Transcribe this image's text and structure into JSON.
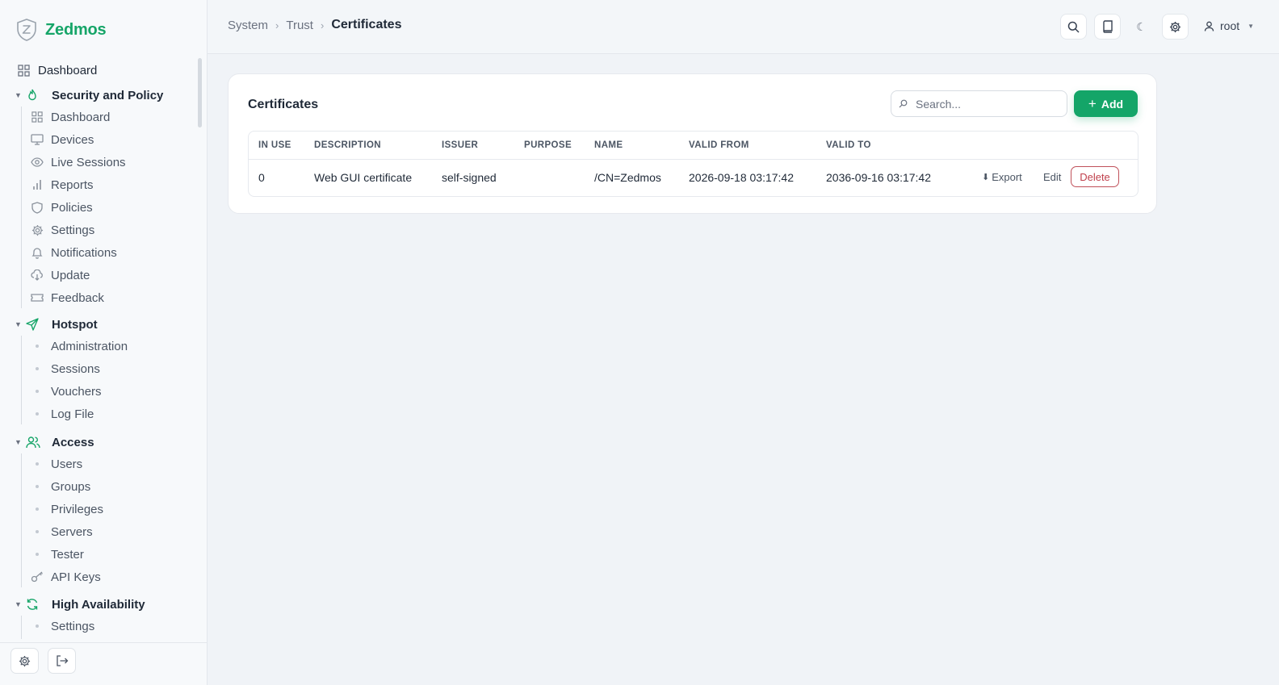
{
  "brand": {
    "name": "Zedmos",
    "color": "#16a568"
  },
  "sidebar": {
    "top_item": {
      "label": "Dashboard",
      "icon": "dashboard-grid-icon"
    },
    "sections": [
      {
        "label": "Security and Policy",
        "icon": "flame-icon",
        "items": [
          {
            "label": "Dashboard",
            "icon": "dashboard-grid-icon"
          },
          {
            "label": "Devices",
            "icon": "monitor-icon"
          },
          {
            "label": "Live Sessions",
            "icon": "eye-icon"
          },
          {
            "label": "Reports",
            "icon": "bar-chart-icon"
          },
          {
            "label": "Policies",
            "icon": "shield-icon"
          },
          {
            "label": "Settings",
            "icon": "gear-icon"
          },
          {
            "label": "Notifications",
            "icon": "bell-icon"
          },
          {
            "label": "Update",
            "icon": "cloud-download-icon"
          },
          {
            "label": "Feedback",
            "icon": "ticket-icon"
          }
        ]
      },
      {
        "label": "Hotspot",
        "icon": "send-icon",
        "items": [
          {
            "label": "Administration"
          },
          {
            "label": "Sessions"
          },
          {
            "label": "Vouchers"
          },
          {
            "label": "Log File"
          }
        ]
      },
      {
        "label": "Access",
        "icon": "users-icon",
        "items": [
          {
            "label": "Users"
          },
          {
            "label": "Groups"
          },
          {
            "label": "Privileges"
          },
          {
            "label": "Servers"
          },
          {
            "label": "Tester"
          },
          {
            "label": "API Keys",
            "icon": "key-icon"
          }
        ]
      },
      {
        "label": "High Availability",
        "icon": "refresh-icon",
        "items": [
          {
            "label": "Settings"
          }
        ]
      }
    ]
  },
  "header": {
    "breadcrumb": [
      "System",
      "Trust"
    ],
    "current": "Certificates",
    "user": "root"
  },
  "card": {
    "title": "Certificates",
    "search_placeholder": "Search...",
    "add_label": "Add"
  },
  "table": {
    "columns": [
      "IN USE",
      "DESCRIPTION",
      "ISSUER",
      "PURPOSE",
      "NAME",
      "VALID FROM",
      "VALID TO"
    ],
    "rows": [
      {
        "in_use": "0",
        "description": "Web GUI certificate",
        "issuer": "self-signed",
        "purpose": "",
        "name": "/CN=Zedmos",
        "valid_from": "2026-09-18 03:17:42",
        "valid_to": "2036-09-16 03:17:42",
        "actions": {
          "export": "Export",
          "edit": "Edit",
          "delete": "Delete"
        }
      }
    ]
  },
  "colors": {
    "accent": "#14a568",
    "danger": "#c0404c"
  }
}
